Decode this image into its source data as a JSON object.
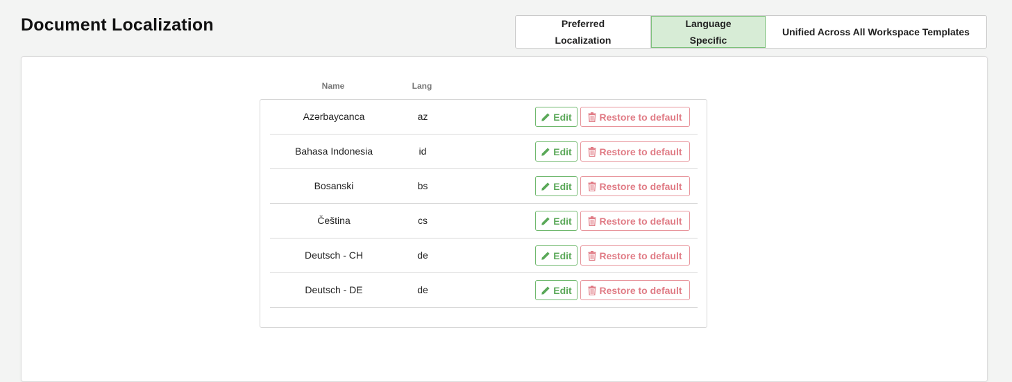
{
  "page": {
    "title": "Document Localization"
  },
  "mode_toggle": {
    "options": [
      {
        "label_line1": "Preferred",
        "label_line2": "Localization",
        "active": false
      },
      {
        "label_line1": "Language",
        "label_line2": "Specific",
        "active": true
      },
      {
        "label_line1": "Unified Across All Workspace Templates",
        "label_line2": "",
        "active": false
      }
    ]
  },
  "table": {
    "headers": {
      "name": "Name",
      "lang": "Lang"
    },
    "actions": {
      "edit_label": "Edit",
      "restore_label": "Restore to default"
    },
    "rows": [
      {
        "name": "Azərbaycanca",
        "lang": "az"
      },
      {
        "name": "Bahasa Indonesia",
        "lang": "id"
      },
      {
        "name": "Bosanski",
        "lang": "bs"
      },
      {
        "name": "Čeština",
        "lang": "cs"
      },
      {
        "name": "Deutsch - CH",
        "lang": "de"
      },
      {
        "name": "Deutsch - DE",
        "lang": "de"
      }
    ]
  },
  "colors": {
    "active_toggle_bg": "#d7ecd6",
    "edit_green": "#5aa858",
    "restore_red": "#e07b85"
  },
  "icons": {
    "edit": "pencil-icon",
    "restore": "trash-icon"
  }
}
